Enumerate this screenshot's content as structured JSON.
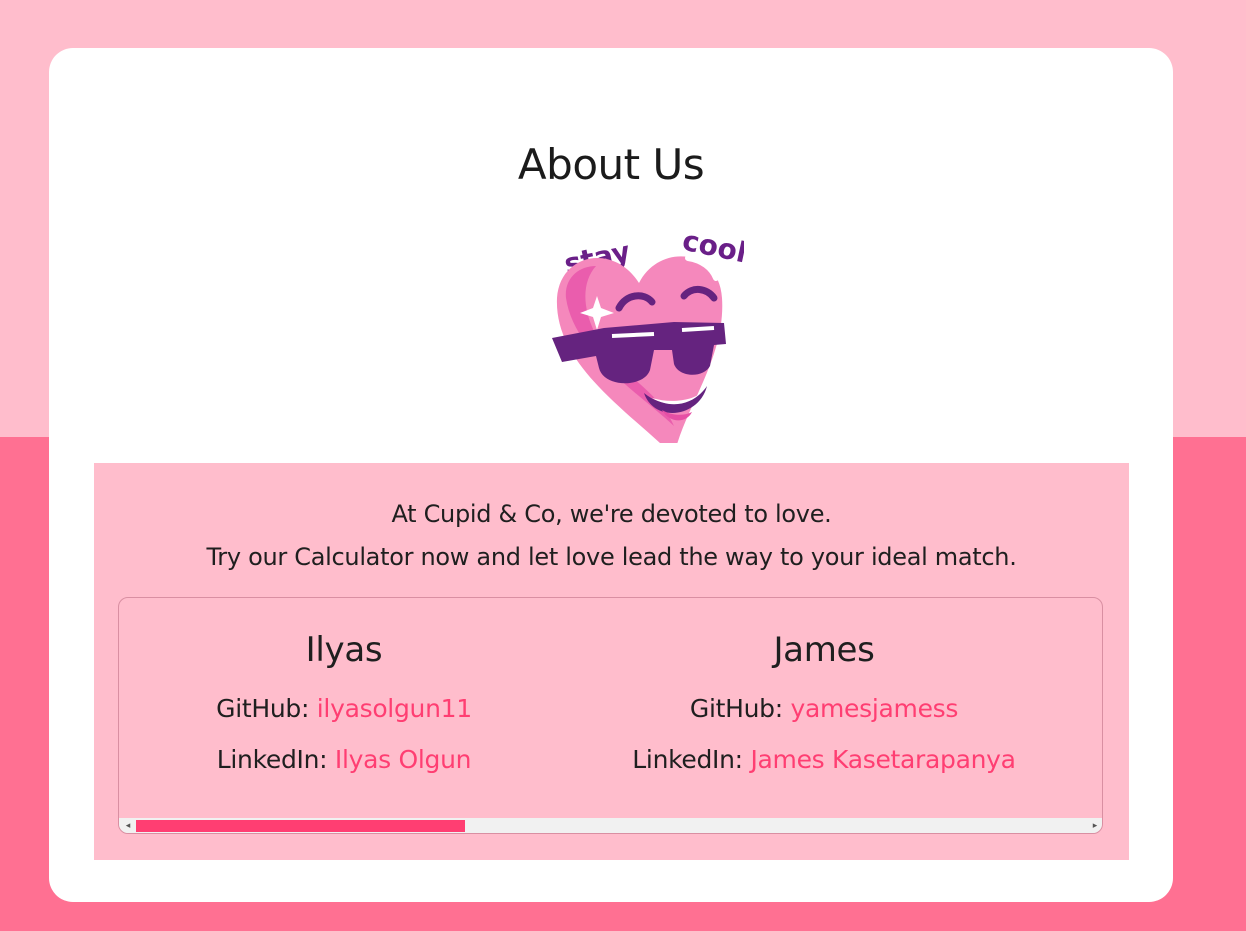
{
  "page": {
    "title": "About Us",
    "mascot": {
      "icon": "cool-heart-mascot-icon",
      "text_left": "stay",
      "text_right": "cool"
    },
    "intro": {
      "line1": "At Cupid & Co, we're devoted to love.",
      "line2": "Try our Calculator now and let love lead the way to your ideal match."
    },
    "team": [
      {
        "name": "Ilyas",
        "github_label": "GitHub: ",
        "github_value": "ilyasolgun11",
        "linkedin_label": "LinkedIn: ",
        "linkedin_value": "Ilyas Olgun"
      },
      {
        "name": "James",
        "github_label": "GitHub: ",
        "github_value": "yamesjamess",
        "linkedin_label": "LinkedIn: ",
        "linkedin_value": "James Kasetarapanya"
      }
    ],
    "scrollbar": {
      "left_icon": "arrow-left-icon",
      "right_icon": "arrow-right-icon",
      "left_glyph": "◂",
      "right_glyph": "▸",
      "position_fraction": 0.34
    }
  },
  "colors": {
    "background_top": "#ffbdcc",
    "background_bottom": "#ff7092",
    "card": "#ffffff",
    "panel": "#ffbdcc",
    "link": "#ff3e72",
    "scroll_thumb": "#ff3e72"
  }
}
